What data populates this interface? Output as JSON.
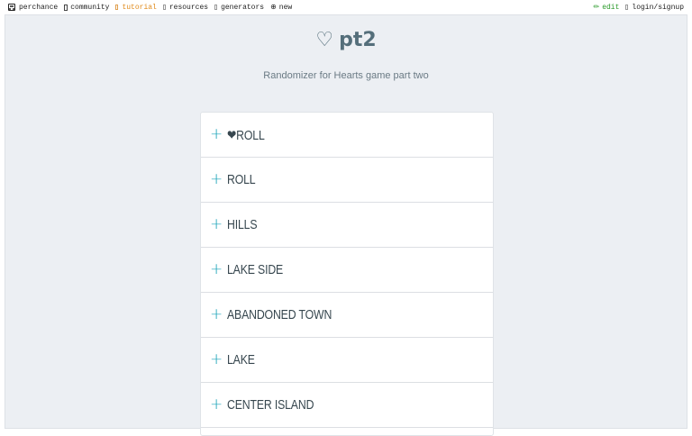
{
  "topbar": {
    "brand": "perchance",
    "community": "community",
    "tutorial": "tutorial",
    "resources": "resources",
    "generators": "generators",
    "new": "new",
    "edit": "edit",
    "login": "login/signup",
    "accent_tutorial": "#e08a1a",
    "accent_edit": "#2a9a2a"
  },
  "page": {
    "heart_glyph": "♡",
    "title": "pt2",
    "subtitle": "Randomizer for Hearts game part two",
    "title_color": "#546e7a"
  },
  "list": {
    "expand_glyph": "+",
    "accent": "#1aa3b8",
    "items": [
      {
        "label": "❤ROLL"
      },
      {
        "label": "ROLL"
      },
      {
        "label": "HILLS"
      },
      {
        "label": "LAKE SIDE"
      },
      {
        "label": "ABANDONED TOWN"
      },
      {
        "label": "LAKE"
      },
      {
        "label": "CENTER ISLAND"
      }
    ]
  }
}
